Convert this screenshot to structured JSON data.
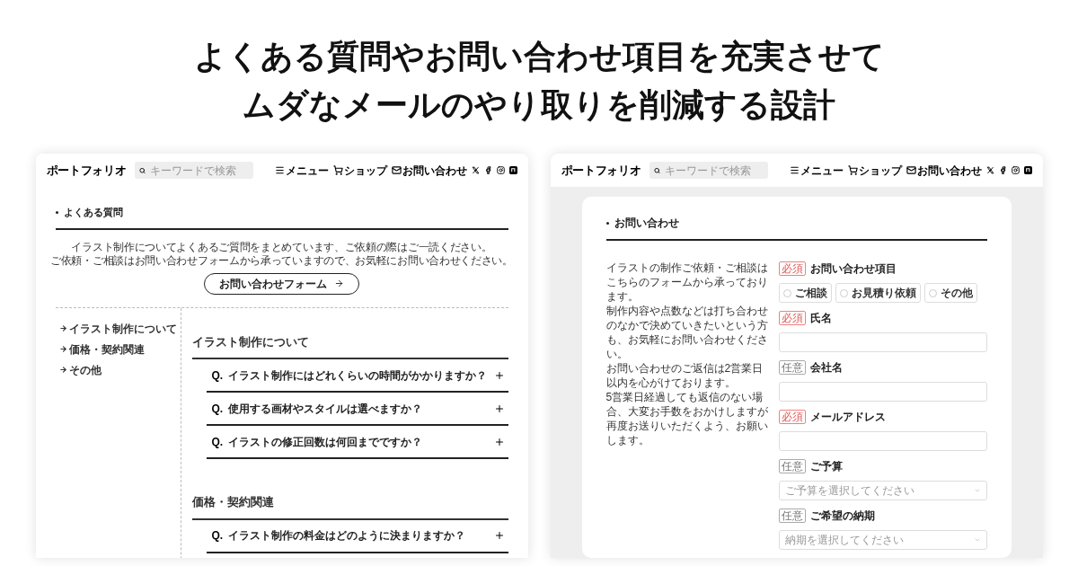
{
  "headline": [
    "よくある質問やお問い合わせ項目を充実させて",
    "ムダなメールのやり取りを削減する設計"
  ],
  "faq_page": {
    "header": {
      "logo": "ポートフォリオ",
      "search_placeholder": "キーワードで検索",
      "nav": [
        {
          "kind": "menu",
          "label": "メニュー"
        },
        {
          "kind": "cart",
          "label": "ショップ"
        },
        {
          "kind": "mail",
          "label": "お問い合わせ"
        }
      ]
    },
    "title": "よくある質問",
    "intro": [
      "イラスト制作についてよくあるご質問をまとめています、ご依頼の際はご一読ください。",
      "ご依頼・ご相談はお問い合わせフォームから承っていますので、お気軽にお問い合わせください。"
    ],
    "form_button": "お問い合わせフォーム",
    "sidebar": [
      "イラスト制作について",
      "価格・契約関連",
      "その他"
    ],
    "sections": [
      {
        "title": "イラスト制作について",
        "items": [
          {
            "q": "Q.",
            "text": "イラスト制作にはどれくらいの時間がかかりますか？",
            "expanded": false
          },
          {
            "q": "Q.",
            "text": "使用する画材やスタイルは選べますか？",
            "expanded": false
          },
          {
            "q": "Q.",
            "text": "イラストの修正回数は何回までですか？",
            "expanded": false
          }
        ]
      },
      {
        "title": "価格・契約関連",
        "items": [
          {
            "q": "Q.",
            "text": "イラスト制作の料金はどのように決まりますか？",
            "expanded": false
          }
        ]
      }
    ]
  },
  "contact_page": {
    "header": {
      "logo": "ポートフォリオ",
      "search_placeholder": "キーワードで検索",
      "nav": [
        {
          "kind": "menu",
          "label": "メニュー"
        },
        {
          "kind": "cart",
          "label": "ショップ"
        },
        {
          "kind": "mail",
          "label": "お問い合わせ"
        }
      ]
    },
    "title": "お問い合わせ",
    "description": [
      "イラストの制作ご依頼・ご相談はこちらのフォームから承っております。",
      "制作内容や点数などは打ち合わせのなかで決めていきたいという方も、お気軽にお問い合わせください。",
      "お問い合わせのご返信は2営業日以内を心がけております。",
      "5営業日経過しても返信のない場合、大変お手数をおかけしますが再度お送りいただくよう、お願いします。"
    ],
    "fields": [
      {
        "kind": "radio",
        "badge": "必須",
        "required": true,
        "label": "お問い合わせ項目",
        "options": [
          {
            "label": "ご相談",
            "selected": false
          },
          {
            "label": "お見積り依頼",
            "selected": false
          },
          {
            "label": "その他",
            "selected": false
          }
        ]
      },
      {
        "kind": "text",
        "badge": "必須",
        "required": true,
        "label": "氏名"
      },
      {
        "kind": "text",
        "badge": "任意",
        "required": false,
        "label": "会社名"
      },
      {
        "kind": "text",
        "badge": "必須",
        "required": true,
        "label": "メールアドレス"
      },
      {
        "kind": "select",
        "badge": "任意",
        "required": false,
        "label": "ご予算",
        "placeholder": "ご予算を選択してください"
      },
      {
        "kind": "select",
        "badge": "任意",
        "required": false,
        "label": "ご希望の納期",
        "placeholder": "納期を選択してください"
      }
    ]
  }
}
